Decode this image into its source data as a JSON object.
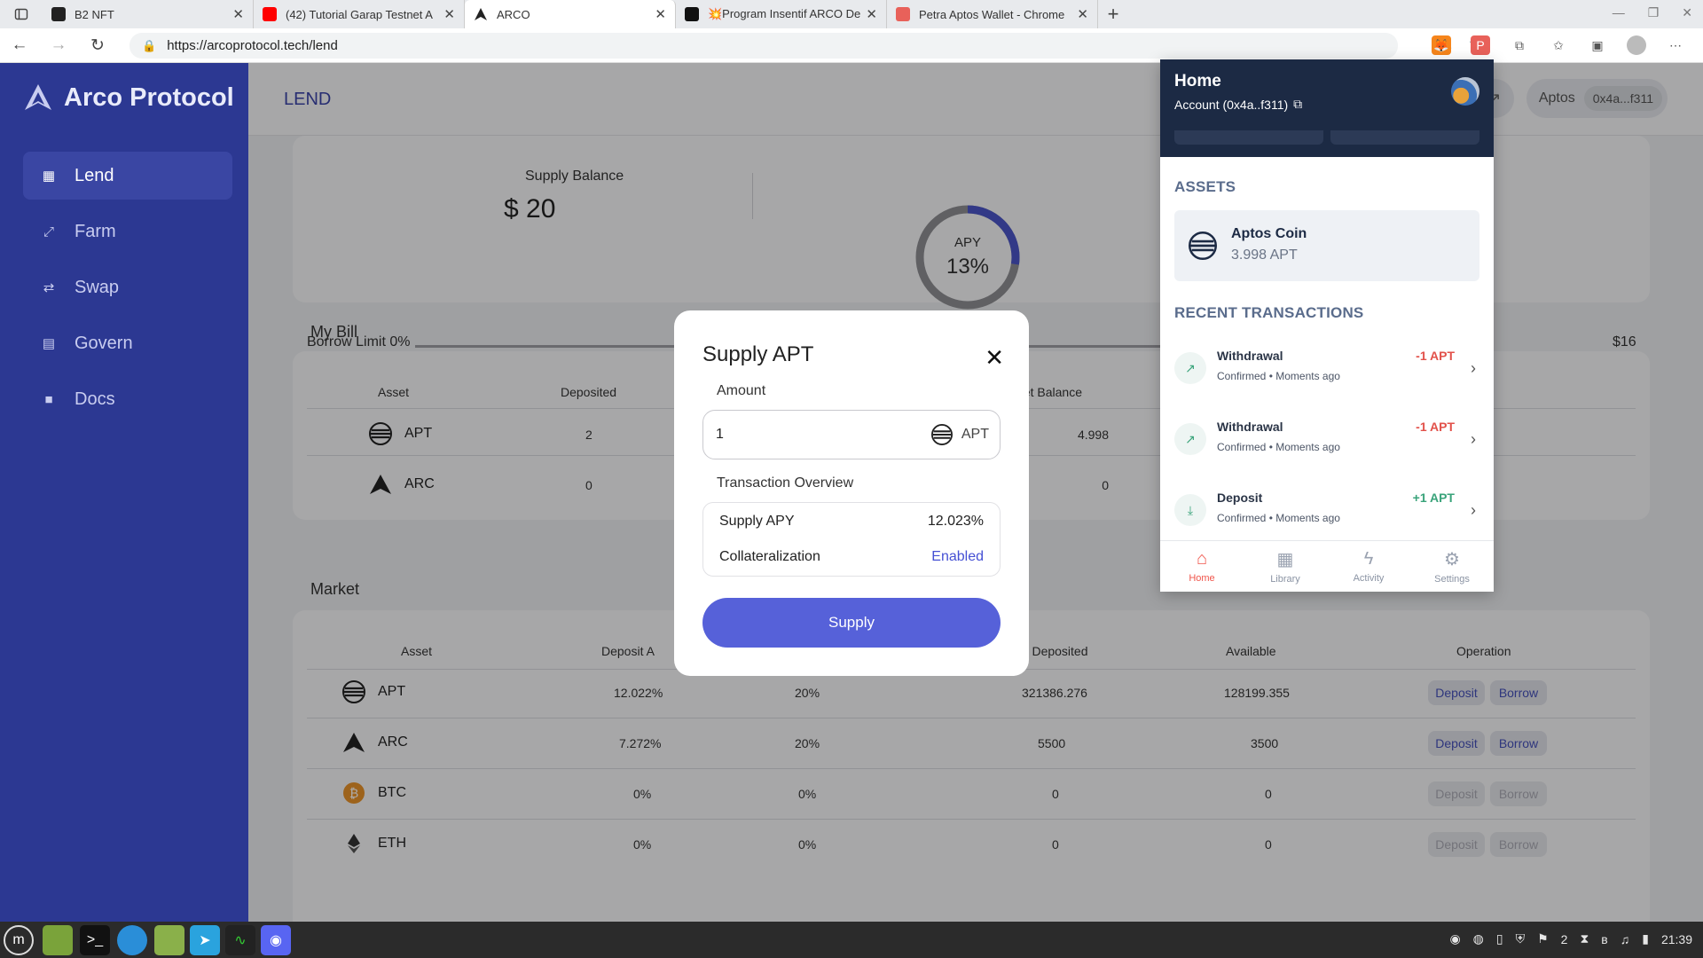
{
  "browser": {
    "tabs": [
      {
        "title": "B2 NFT",
        "favicon_color": "#222222"
      },
      {
        "title": "(42) Tutorial Garap Testnet A",
        "favicon_color": "#ff0000"
      },
      {
        "title": "ARCO",
        "favicon_color": "#222222"
      },
      {
        "title": "💥Program Insentif ARCO De",
        "favicon_color": "#111111"
      },
      {
        "title": "Petra Aptos Wallet - Chrome",
        "favicon_color": "#e8615a"
      }
    ],
    "url": "https://arcoprotocol.tech/lend"
  },
  "sidebar": {
    "brand": "Arco Protocol",
    "items": [
      {
        "label": "Lend",
        "icon": "grid-icon"
      },
      {
        "label": "Farm",
        "icon": "pickaxe-icon"
      },
      {
        "label": "Swap",
        "icon": "swap-icon"
      },
      {
        "label": "Govern",
        "icon": "document-icon"
      },
      {
        "label": "Docs",
        "icon": "book-icon"
      }
    ]
  },
  "header": {
    "title": "LEND",
    "chain": "Aptos",
    "address": "0x4a...f311"
  },
  "overview": {
    "supply_label": "Supply Balance",
    "supply_value": "$ 20",
    "apy_label": "APY",
    "apy_value": "13%",
    "apy_fraction": 0.13,
    "borrow_limit": "Borrow Limit 0%",
    "borrow_max": "$16"
  },
  "bill": {
    "title": "My Bill",
    "headers": [
      "Asset",
      "Deposited",
      "Wallet Balance"
    ],
    "rows": [
      {
        "asset": "APT",
        "deposited": "2",
        "wallet": "4.998"
      },
      {
        "asset": "ARC",
        "deposited": "0",
        "wallet": "0"
      }
    ]
  },
  "market": {
    "title": "Market",
    "headers": [
      "Asset",
      "Deposit A",
      "Total Deposited",
      "Available",
      "Operation"
    ],
    "deposit_label": "Deposit",
    "borrow_label": "Borrow",
    "rows": [
      {
        "asset": "APT",
        "deposit_apy": "12.022%",
        "collateral": "20%",
        "total": "321386.276",
        "available": "128199.355",
        "enabled": true
      },
      {
        "asset": "ARC",
        "deposit_apy": "7.272%",
        "collateral": "20%",
        "total": "5500",
        "available": "3500",
        "enabled": true
      },
      {
        "asset": "BTC",
        "deposit_apy": "0%",
        "collateral": "0%",
        "total": "0",
        "available": "0",
        "enabled": false
      },
      {
        "asset": "ETH",
        "deposit_apy": "0%",
        "collateral": "0%",
        "total": "0",
        "available": "0",
        "enabled": false
      }
    ]
  },
  "modal": {
    "title": "Supply APT",
    "amount_label": "Amount",
    "amount_value": "1",
    "amount_unit": "APT",
    "overview_label": "Transaction Overview",
    "supply_apy_label": "Supply APY",
    "supply_apy_value": "12.023%",
    "collateral_label": "Collateralization",
    "collateral_value": "Enabled",
    "supply_button": "Supply"
  },
  "wallet": {
    "title": "Home",
    "account": "Account (0x4a..f311)",
    "assets_title": "ASSETS",
    "asset_name": "Aptos Coin",
    "asset_balance": "3.998 APT",
    "recent_title": "RECENT TRANSACTIONS",
    "transactions": [
      {
        "type": "Withdrawal",
        "status": "Confirmed • Moments ago",
        "amount": "-1 APT"
      },
      {
        "type": "Withdrawal",
        "status": "Confirmed • Moments ago",
        "amount": "-1 APT"
      },
      {
        "type": "Deposit",
        "status": "Confirmed • Moments ago",
        "amount": "+1 APT"
      }
    ],
    "footer": [
      "Home",
      "Library",
      "Activity",
      "Settings"
    ]
  },
  "taskbar": {
    "clock": "21:39",
    "tray_count": "2"
  },
  "colors": {
    "sidebar": "#2c3892",
    "accent": "#5661d9",
    "wallet_header": "#1c2a44"
  }
}
